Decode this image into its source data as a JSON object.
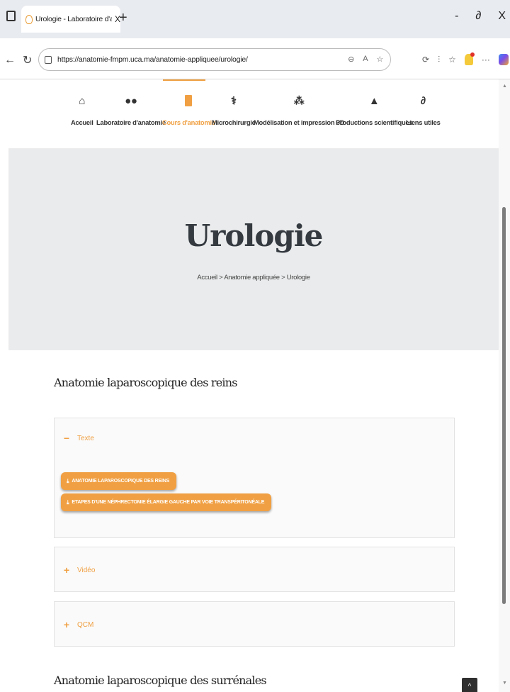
{
  "browser": {
    "tab_title": "Urologie - Laboratoire d'anatomie",
    "tab_close": "X",
    "new_tab": "+",
    "window_controls": {
      "minimize": "-",
      "restore": "∂",
      "close": "X"
    },
    "url": "https://anatomie-fmpm.uca.ma/anatomie-appliquee/urologie/",
    "toolbar_more": "···"
  },
  "site_nav": {
    "items": [
      {
        "label": "Accueil",
        "icon": "home-icon"
      },
      {
        "label": "Laboratoire d'anatomie",
        "icon": "users-icon"
      },
      {
        "label": "Cours d'anatomie",
        "icon": "book-icon",
        "active": true
      },
      {
        "label": "Microchirurgie",
        "icon": "doctor-icon"
      },
      {
        "label": "Modélisation et impression 3D",
        "icon": "cubes-icon"
      },
      {
        "label": "Productions scientifiques",
        "icon": "graduation-cap-icon"
      },
      {
        "label": "Liens utiles",
        "icon": "link-icon"
      }
    ],
    "active_color": "#f0a043"
  },
  "hero": {
    "title": "Urologie",
    "breadcrumb": "Accueil > Anatomie appliquée > Urologie"
  },
  "sections": [
    {
      "title": "Anatomie laparoscopique des reins",
      "accordions": [
        {
          "label": "Texte",
          "state": "expanded",
          "sign": "−",
          "buttons": [
            "ANATOMIE LAPAROSCOPIQUE DES REINS",
            "ETAPES D'UNE NÉPHRECTOMIE ÉLARGIE GAUCHE PAR VOIE TRANSPÉRITONÉALE"
          ]
        },
        {
          "label": "Vidéo",
          "state": "collapsed",
          "sign": "+"
        },
        {
          "label": "QCM",
          "state": "collapsed",
          "sign": "+"
        }
      ]
    },
    {
      "title": "Anatomie laparoscopique des surrénales"
    }
  ],
  "scroll_to_top": "^",
  "colors": {
    "accent": "#f0a043",
    "hero_bg": "#eaebec",
    "title": "#343a40"
  }
}
